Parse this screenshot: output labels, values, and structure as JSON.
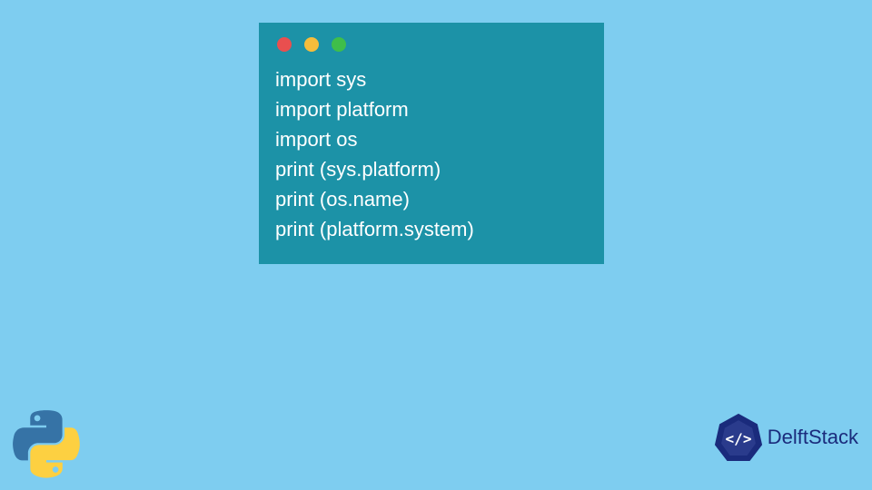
{
  "code": {
    "lines": [
      "import sys",
      "import platform",
      "import os",
      "print (sys.platform)",
      "print (os.name)",
      "print (platform.system)"
    ]
  },
  "branding": {
    "name": "DelftStack"
  }
}
